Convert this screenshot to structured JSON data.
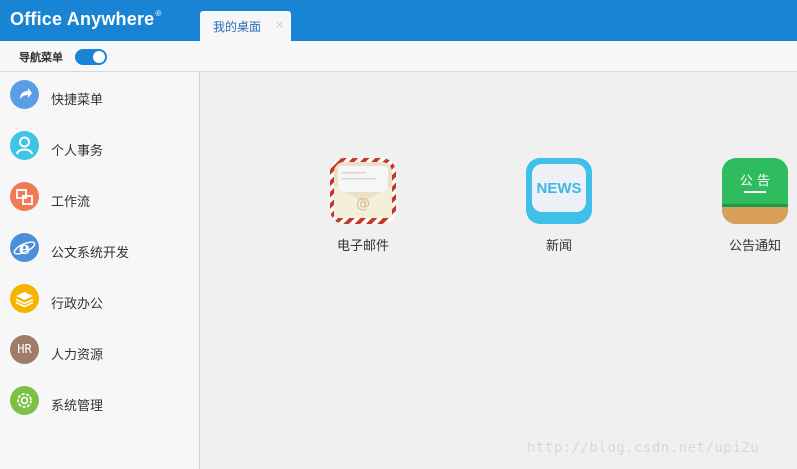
{
  "header": {
    "logo_text": "Office Anywhere",
    "logo_mark": "®",
    "brand_color": "#1a84d4",
    "tab": {
      "label": "我的桌面",
      "close_symbol": "×"
    }
  },
  "navbar": {
    "label": "导航菜单",
    "toggle_on": true
  },
  "sidebar": {
    "items": [
      {
        "label": "快捷菜单",
        "icon": "share-arrow-icon",
        "color": "#5b9ee6"
      },
      {
        "label": "个人事务",
        "icon": "person-icon",
        "color": "#3ec4e4"
      },
      {
        "label": "工作流",
        "icon": "workflow-icon",
        "color": "#f07a56"
      },
      {
        "label": "公文系统开发",
        "icon": "ie-browser-icon",
        "color": "#4a8fd8"
      },
      {
        "label": "行政办公",
        "icon": "layers-icon",
        "color": "#f5b400"
      },
      {
        "label": "人力资源",
        "icon": "hr-icon",
        "icon_text": "HR",
        "color": "#a07a6a"
      },
      {
        "label": "系统管理",
        "icon": "gear-icon",
        "color": "#7cc046"
      }
    ]
  },
  "desktop": {
    "apps": [
      {
        "label": "电子邮件",
        "icon": "email-icon"
      },
      {
        "label": "新闻",
        "icon": "news-icon",
        "icon_text": "NEWS"
      },
      {
        "label": "公告通知",
        "icon": "notice-board-icon",
        "icon_text": "公 告"
      }
    ]
  },
  "watermark": "http://blog.csdn.net/upi2u"
}
